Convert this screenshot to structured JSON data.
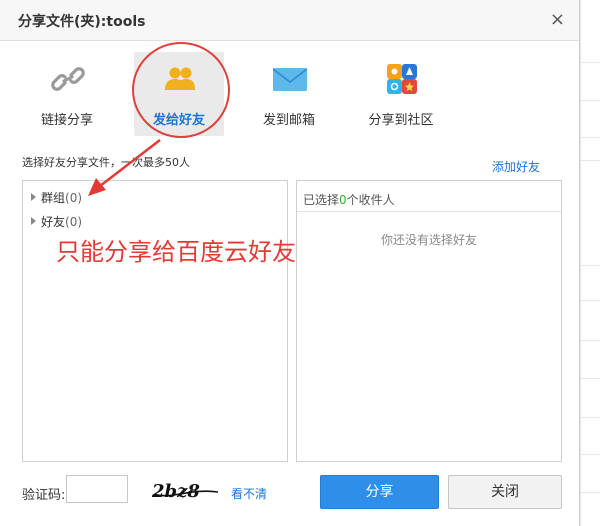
{
  "dialog": {
    "title": "分享文件(夹):tools",
    "close_glyph": "×"
  },
  "tabs": [
    {
      "label": "链接分享",
      "icon": "link-icon",
      "active": false
    },
    {
      "label": "发给好友",
      "icon": "friends-icon",
      "active": true
    },
    {
      "label": "发到邮箱",
      "icon": "mail-icon",
      "active": false
    },
    {
      "label": "分享到社区",
      "icon": "community-apps-icon",
      "active": false
    }
  ],
  "hint": "选择好友分享文件，一次最多50人",
  "add_friend": "添加好友",
  "tree": [
    {
      "label": "群组",
      "count": "(0)"
    },
    {
      "label": "好友",
      "count": "(0)"
    }
  ],
  "selected": {
    "prefix": "已选择",
    "count": "0",
    "suffix": "个收件人",
    "empty": "你还没有选择好友"
  },
  "annotation": "只能分享给百度云好友",
  "captcha": {
    "label": "验证码:",
    "value": "",
    "refresh": "看不清",
    "image_text": "2bz8"
  },
  "buttons": {
    "share": "分享",
    "close": "关闭"
  },
  "colors": {
    "accent": "#2f8ee8",
    "annotation_red": "#e33a36",
    "link_blue": "#1d73d6",
    "count_green": "#2bb22b"
  }
}
